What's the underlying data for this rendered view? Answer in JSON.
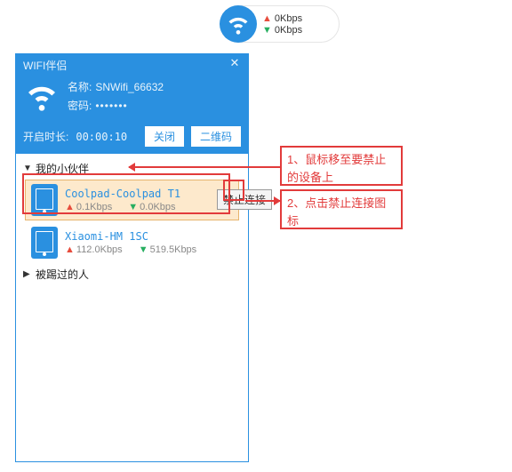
{
  "pill": {
    "up": "0Kbps",
    "down": "0Kbps"
  },
  "panel": {
    "title": "WIFI伴侣",
    "name_label": "名称:",
    "name_value": "SNWifi_66632",
    "pwd_label": "密码:",
    "pwd_value": "•••••••",
    "uptime_label": "开启时长:",
    "uptime_value": "00:00:10",
    "close_btn": "关闭",
    "qr_btn": "二维码"
  },
  "sections": {
    "partners": "我的小伙伴",
    "blocked": "被踢过的人"
  },
  "devices": [
    {
      "name": "Coolpad-Coolpad T1",
      "up": "0.1Kbps",
      "down": "0.0Kbps"
    },
    {
      "name": "Xiaomi-HM 1SC",
      "up": "112.0Kbps",
      "down": "519.5Kbps"
    }
  ],
  "tooltip": "禁止连接",
  "annotations": {
    "step1": "1、鼠标移至要禁止的设备上",
    "step2": "2、点击禁止连接图标"
  }
}
